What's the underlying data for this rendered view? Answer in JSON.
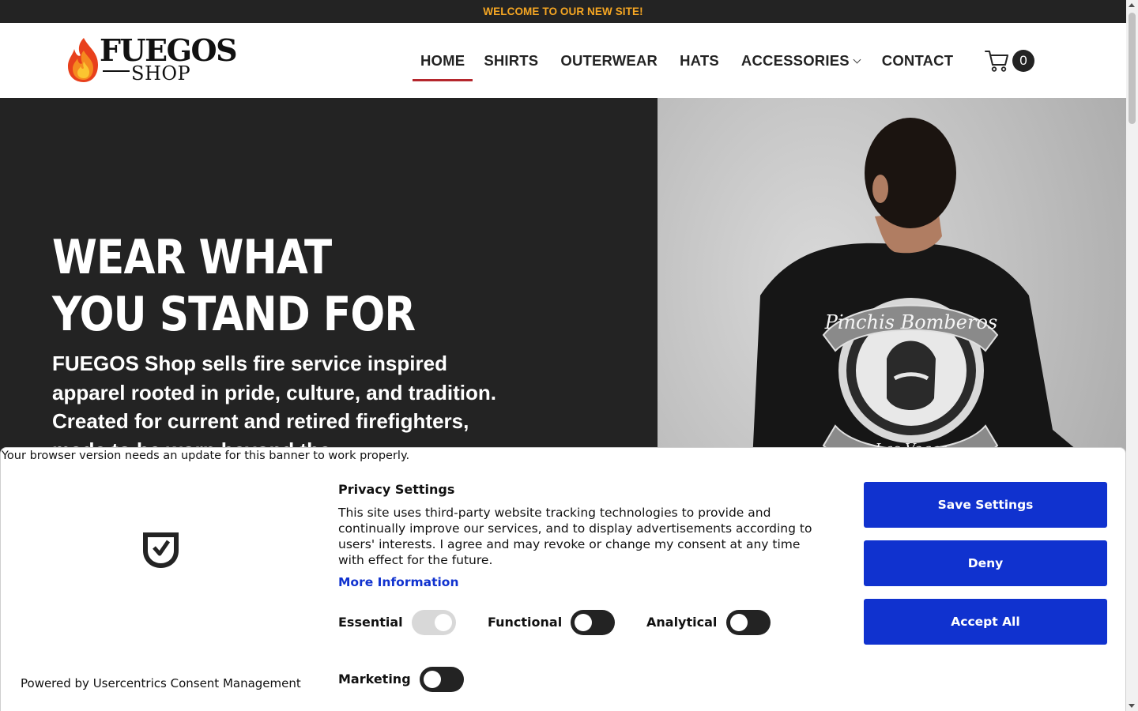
{
  "announcement": {
    "text": "WELCOME TO OUR NEW SITE!"
  },
  "brand": {
    "name_line1": "FUEGOS",
    "name_line2": "SHOP"
  },
  "nav": {
    "items": [
      {
        "label": "HOME",
        "active": true
      },
      {
        "label": "SHIRTS"
      },
      {
        "label": "OUTERWEAR"
      },
      {
        "label": "HATS"
      },
      {
        "label": "ACCESSORIES",
        "has_dropdown": true
      },
      {
        "label": "CONTACT"
      }
    ]
  },
  "cart": {
    "count": "0",
    "icon": "cart-icon"
  },
  "hero": {
    "title_line1": "WEAR WHAT",
    "title_line2": "YOU STAND FOR",
    "text": "FUEGOS Shop sells fire service inspired apparel rooted in pride, culture, and tradition. Created for current and retired firefighters, made to be worn beyond the",
    "image_alt": "Man wearing black Pinchis Bomberos Las Vegas t-shirt",
    "shirt_graphic_top": "Pinchis Bomberos",
    "shirt_graphic_bottom": "Las Vegas"
  },
  "consent": {
    "browser_warning": "Your browser version needs an update for this banner to work properly.",
    "powered_by": "Powered by Usercentrics Consent Management",
    "title": "Privacy Settings",
    "description": "This site uses third-party website tracking technologies to provide and continually improve our services, and to display advertisements according to users' interests. I agree and may revoke or change my consent at any time with effect for the future.",
    "more_info": "More Information",
    "categories": {
      "essential": "Essential",
      "functional": "Functional",
      "analytical": "Analytical",
      "marketing": "Marketing"
    },
    "buttons": {
      "save": "Save Settings",
      "deny": "Deny",
      "accept": "Accept All"
    }
  },
  "colors": {
    "accent_orange": "#f5a623",
    "nav_underline": "#b5272d",
    "consent_blue": "#1032cf",
    "dark": "#232323"
  }
}
